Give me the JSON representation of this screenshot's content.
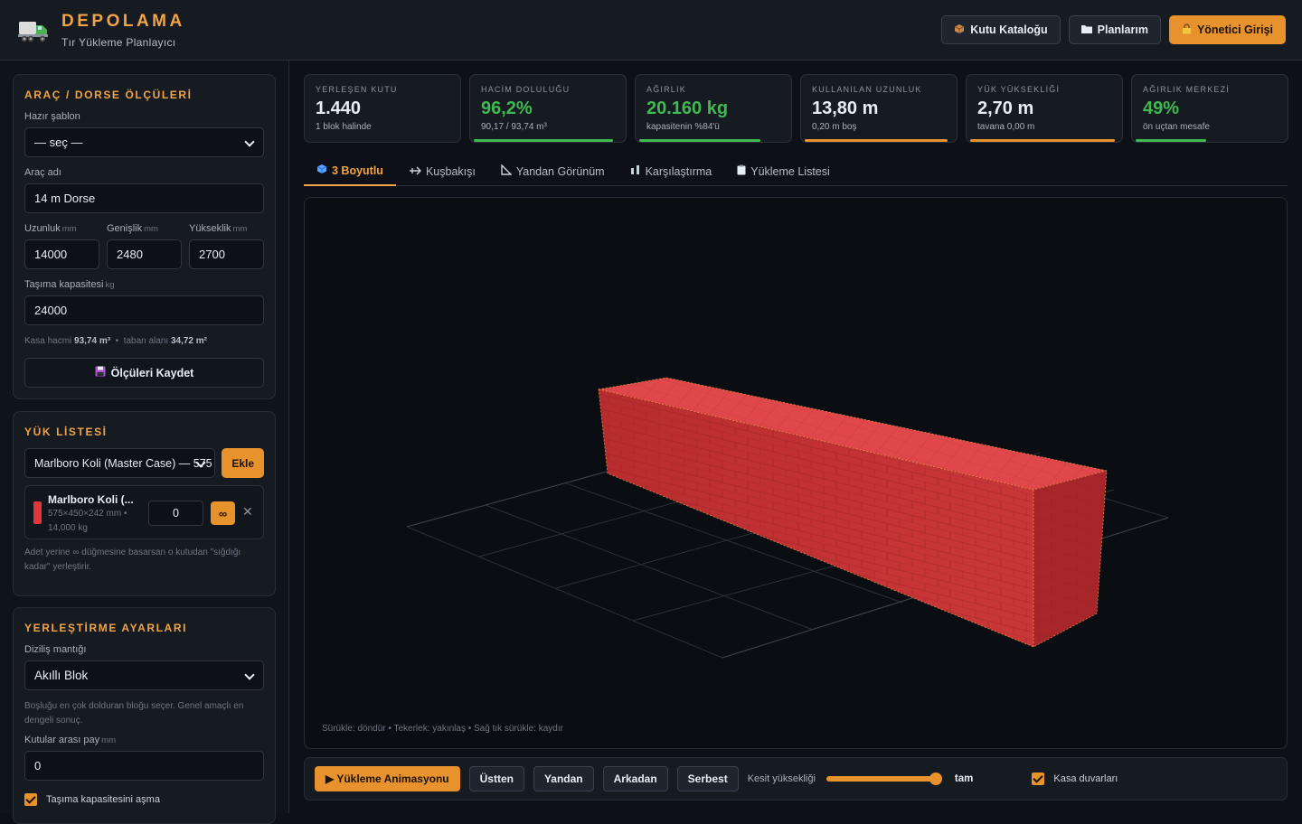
{
  "header": {
    "brand_title": "DEPOLAMA",
    "brand_subtitle": "Tır Yükleme Planlayıcı",
    "buttons": {
      "catalog": "Kutu Kataloğu",
      "plans": "Planlarım",
      "admin": "Yönetici Girişi"
    },
    "icons": {
      "logo": "truck-icon",
      "catalog": "box-icon",
      "plans": "folder-icon",
      "admin": "lock-icon"
    }
  },
  "vehicle": {
    "title": "ARAÇ / DORSE ÖLÇÜLERİ",
    "template_label": "Hazır şablon",
    "template_value": "— seç —",
    "name_label": "Araç adı",
    "name_value": "14 m Dorse",
    "length_label": "Uzunluk",
    "width_label": "Genişlik",
    "height_label": "Yükseklik",
    "unit_mm": "mm",
    "length_value": "14000",
    "width_value": "2480",
    "height_value": "2700",
    "capacity_label": "Taşıma kapasitesi",
    "unit_kg": "kg",
    "capacity_value": "24000",
    "volume_label": "Kasa hacmi",
    "volume_value": "93,74 m³",
    "floor_label": "taban alanı",
    "floor_value": "34,72 m²",
    "save_button": "Ölçüleri Kaydet"
  },
  "cargo": {
    "title": "YÜK LİSTESİ",
    "select_value": "Marlboro Koli (Master Case) — 575",
    "add_button": "Ekle",
    "item": {
      "name": "Marlboro Koli (...",
      "dims": "575×450×242 mm •",
      "weight": "14,000 kg",
      "qty": "0",
      "color": "#e0353b",
      "fill_symbol": "∞",
      "remove_symbol": "✕"
    },
    "hint": "Adet yerine ∞ düğmesine basarsan o kutudan \"sığdığı kadar\" yerleştirir."
  },
  "placement": {
    "title": "YERLEŞTİRME AYARLARI",
    "logic_label": "Diziliş mantığı",
    "logic_value": "Akıllı Blok",
    "logic_hint": "Boşluğu en çok dolduran bloğu seçer. Genel amaçlı en dengeli sonuç.",
    "gap_label": "Kutular arası pay",
    "gap_unit": "mm",
    "gap_value": "0",
    "capacity_check": "Taşıma kapasitesini aşma"
  },
  "stats": [
    {
      "title": "YERLEŞEN KUTU",
      "value": "1.440",
      "sub": "1 blok halinde",
      "color": "#e6edf3"
    },
    {
      "title": "HACİM DOLULUĞU",
      "value": "96,2%",
      "sub": "90,17 / 93,74 m³",
      "color": "#3fb950",
      "bar": 0.962,
      "bar_color": "#3fb950"
    },
    {
      "title": "AĞIRLIK",
      "value": "20.160 kg",
      "sub": "kapasitenin %84'ü",
      "color": "#3fb950",
      "bar": 0.84,
      "bar_color": "#3fb950"
    },
    {
      "title": "KULLANILAN UZUNLUK",
      "value": "13,80 m",
      "sub": "0,20 m boş",
      "color": "#e6edf3",
      "bar": 0.986,
      "bar_color": "#e8922e"
    },
    {
      "title": "YÜK YÜKSEKLİĞİ",
      "value": "2,70 m",
      "sub": "tavana 0,00 m",
      "color": "#e6edf3",
      "bar": 1.0,
      "bar_color": "#e8922e"
    },
    {
      "title": "AĞIRLIK MERKEZİ",
      "value": "49%",
      "sub": "ön uçtan mesafe",
      "color": "#3fb950",
      "bar": 0.49,
      "bar_color": "#3fb950"
    }
  ],
  "tabs": [
    {
      "label": "3 Boyutlu",
      "icon": "cube-icon",
      "active": true
    },
    {
      "label": "Kuşbakışı",
      "icon": "plane-icon"
    },
    {
      "label": "Yandan Görünüm",
      "icon": "ruler-icon"
    },
    {
      "label": "Karşılaştırma",
      "icon": "compare-icon"
    },
    {
      "label": "Yükleme Listesi",
      "icon": "clipboard-icon"
    }
  ],
  "viewport": {
    "hint": "Sürükle: döndür  •  Tekerlek: yakınlaş  •  Sağ tık sürükle: kaydır",
    "box_color": "#d63a3a"
  },
  "toolbar": {
    "animate": "▶ Yükleme Animasyonu",
    "top": "Üstten",
    "side": "Yandan",
    "back": "Arkadan",
    "free": "Serbest",
    "section_label": "Kesit yüksekliği",
    "section_value": "tam",
    "section_level": 1.0,
    "walls_label": "Kasa duvarları"
  }
}
